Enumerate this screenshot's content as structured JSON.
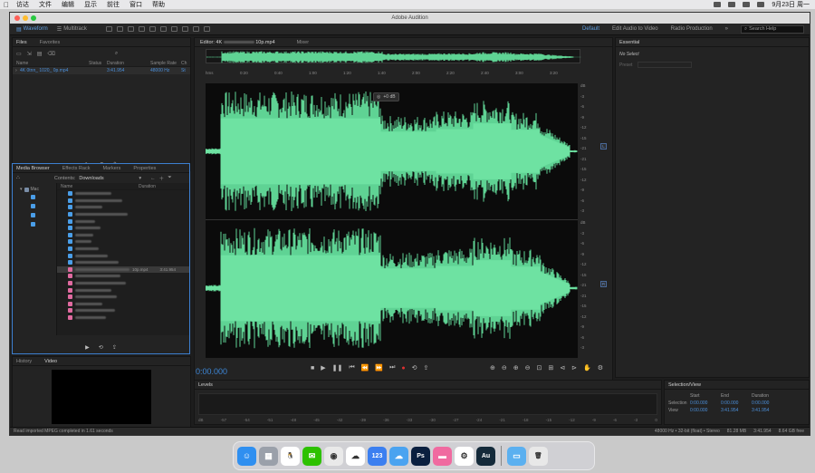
{
  "menubar": {
    "items": [
      "访达",
      "文件",
      "编辑",
      "显示",
      "前往",
      "窗口",
      "帮助"
    ],
    "clock": "9月23日 周一"
  },
  "window": {
    "title": "Adobe Audition"
  },
  "toolbar": {
    "waveform": "Waveform",
    "multitrack": "Multitrack",
    "workspaces": [
      "Default",
      "Edit Audio to Video",
      "Radio Production"
    ],
    "search_placeholder": "Search Help"
  },
  "files_panel": {
    "tabs": [
      "Files",
      "Favorites"
    ],
    "columns": [
      "Name",
      "Status",
      "Duration",
      "Sample Rate",
      "Ch"
    ],
    "file": {
      "name": "4K 0tnn_ 1020_ 0p.mp4",
      "duration": "3:41.954",
      "rate": "48000 Hz",
      "ch": "St"
    }
  },
  "media_browser": {
    "tabs": [
      "Media Browser",
      "Effects Rack",
      "Markers",
      "Properties"
    ],
    "contents_label": "Contents:",
    "location": "Downloads",
    "columns": [
      "Name",
      "Duration"
    ],
    "root_label": "Mac",
    "highlight_name": "10p.mp4",
    "highlight_duration": "3:41.954"
  },
  "bottom_left": {
    "tabs": [
      "History",
      "Video"
    ]
  },
  "editor": {
    "tabs": [
      "Editor: 4K",
      "10p.mp4",
      "Mixer"
    ],
    "ruler": [
      "hms",
      "0:20",
      "0:40",
      "1:00",
      "1:20",
      "1:40",
      "2:00",
      "2:20",
      "2:40",
      "3:00",
      "3:20"
    ],
    "db_top": [
      "dB",
      "-3",
      "-6",
      "-9",
      "-12",
      "-15",
      "-21",
      "-21",
      "-15",
      "-12",
      "-9",
      "-6",
      "-3"
    ],
    "db_bottom": [
      "dB",
      "-3",
      "-6",
      "-9",
      "-12",
      "-15",
      "-21",
      "-21",
      "-15",
      "-12",
      "-9",
      "-6",
      "-3"
    ],
    "channel_top": "L",
    "channel_bottom": "R",
    "hud_db": "+0 dB",
    "timecode": "0:00.000"
  },
  "essential": {
    "tab": "Essential",
    "no_select": "No Select",
    "preset": "Preset"
  },
  "levels": {
    "tab": "Levels",
    "scale": [
      "dB",
      "-57",
      "-54",
      "-51",
      "-48",
      "-45",
      "-42",
      "-39",
      "-36",
      "-33",
      "-30",
      "-27",
      "-24",
      "-21",
      "-18",
      "-15",
      "-12",
      "-9",
      "-6",
      "-3",
      "0"
    ]
  },
  "selection_view": {
    "tab": "Selection/View",
    "headers": [
      "Start",
      "End",
      "Duration"
    ],
    "selection": {
      "label": "Selection",
      "start": "0:00.000",
      "end": "0:00.000",
      "duration": "0:00.000"
    },
    "view": {
      "label": "View",
      "start": "0:00.000",
      "end": "3:41.954",
      "duration": "3:41.954"
    }
  },
  "status": {
    "left": "Read imported MPEG completed in 1.61 seconds",
    "right": [
      "48000 Hz • 32-bit (float) • Stereo",
      "81.28 MB",
      "3:41.954",
      "8.64 GB free"
    ]
  },
  "dock": {
    "apps": [
      {
        "name": "finder",
        "color": "#2f8ff0",
        "glyph": "☺"
      },
      {
        "name": "launchpad",
        "color": "#9aa0aa",
        "glyph": "▦"
      },
      {
        "name": "qq",
        "color": "#ffffff",
        "glyph": "🐧"
      },
      {
        "name": "wechat",
        "color": "#2dc100",
        "glyph": "✉"
      },
      {
        "name": "chrome",
        "color": "#e9e9e9",
        "glyph": "◉"
      },
      {
        "name": "baidu-netdisk",
        "color": "#ffffff",
        "glyph": "☁"
      },
      {
        "name": "app-123",
        "color": "#3b7ff0",
        "glyph": "123"
      },
      {
        "name": "cloud",
        "color": "#4aa3f0",
        "glyph": "☁"
      },
      {
        "name": "photoshop",
        "color": "#0a1f3f",
        "glyph": "Ps"
      },
      {
        "name": "app-pink",
        "color": "#f06aa0",
        "glyph": "▬"
      },
      {
        "name": "app-green",
        "color": "#ffffff",
        "glyph": "⚙"
      },
      {
        "name": "audition",
        "color": "#142a3a",
        "glyph": "Au"
      },
      {
        "name": "folder",
        "color": "#5bb0f0",
        "glyph": "▭"
      },
      {
        "name": "trash",
        "color": "#e8e8e8",
        "glyph": "🗑"
      }
    ]
  }
}
